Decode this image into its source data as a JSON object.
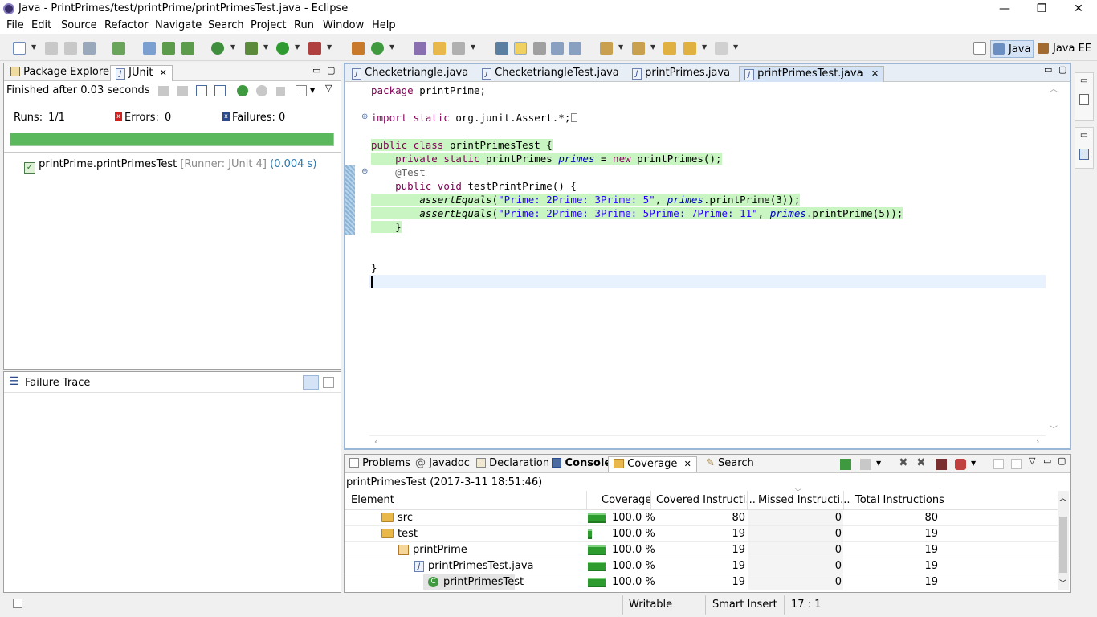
{
  "window": {
    "title": "Java - PrintPrimes/test/printPrime/printPrimesTest.java - Eclipse",
    "minimize": "—",
    "restore": "❐",
    "close": "✕"
  },
  "menu": [
    "File",
    "Edit",
    "Source",
    "Refactor",
    "Navigate",
    "Search",
    "Project",
    "Run",
    "Window",
    "Help"
  ],
  "perspectives": {
    "java": "Java",
    "javaee": "Java EE"
  },
  "left_panel": {
    "tabs": {
      "package_explorer": "Package Explorer",
      "junit": "JUnit"
    },
    "finished": "Finished after 0.03 seconds",
    "runs_label": "Runs:",
    "runs_value": "1/1",
    "errors_label": "Errors:",
    "errors_value": "0",
    "failures_label": "Failures:",
    "failures_value": "0",
    "progress": 1.0,
    "test_name": "printPrime.printPrimesTest",
    "test_runner": "[Runner: JUnit 4]",
    "test_time": "(0.004 s)",
    "failure_trace": "Failure Trace"
  },
  "editor": {
    "tabs": [
      "Checketriangle.java",
      "ChecketriangleTest.java",
      "printPrimes.java",
      "printPrimesTest.java"
    ],
    "active_tab": "printPrimesTest.java",
    "lines": {
      "l1_kw": "package",
      "l1_rest": " printPrime;",
      "l3_kw": "import static",
      "l3_rest": " org.junit.Assert.*;",
      "l5_kw": "public class",
      "l5_rest": " printPrimesTest {",
      "l6_kw": "private static",
      "l6_type": " printPrimes ",
      "l6_field": "primes",
      "l6_eq": " = ",
      "l6_new": "new",
      "l6_rest": " printPrimes();",
      "l7_ann": "@Test",
      "l8_kw": "public void",
      "l8_rest": " testPrintPrime() {",
      "l9_method": "assertEquals",
      "l9_open": "(",
      "l9_str": "\"Prime: 2Prime: 3Prime: 5\"",
      "l9_comma": ", ",
      "l9_field": "primes",
      "l9_rest": ".printPrime(3));",
      "l10_method": "assertEquals",
      "l10_open": "(",
      "l10_str": "\"Prime: 2Prime: 3Prime: 5Prime: 7Prime: 11\"",
      "l10_comma": ", ",
      "l10_field": "primes",
      "l10_rest": ".printPrime(5));",
      "l11": "}",
      "l14": "}"
    }
  },
  "bottom_panel": {
    "tabs": {
      "problems": "Problems",
      "javadoc": "Javadoc",
      "declaration": "Declaration",
      "console": "Console",
      "coverage": "Coverage",
      "search": "Search"
    },
    "session": "printPrimesTest (2017-3-11 18:51:46)",
    "columns": [
      "Element",
      "Coverage",
      "Covered Instructi...",
      "Missed Instructi...",
      "Total Instructions"
    ],
    "rows": [
      {
        "name": "src",
        "coverage": "100.0 %",
        "covered": "80",
        "missed": "0",
        "total": "80"
      },
      {
        "name": "test",
        "coverage": "100.0 %",
        "covered": "19",
        "missed": "0",
        "total": "19"
      },
      {
        "name": "printPrime",
        "coverage": "100.0 %",
        "covered": "19",
        "missed": "0",
        "total": "19"
      },
      {
        "name": "printPrimesTest.java",
        "coverage": "100.0 %",
        "covered": "19",
        "missed": "0",
        "total": "19"
      },
      {
        "name": "printPrimesTest",
        "coverage": "100.0 %",
        "covered": "19",
        "missed": "0",
        "total": "19"
      }
    ]
  },
  "status": {
    "writable": "Writable",
    "insert": "Smart Insert",
    "position": "17 : 1"
  }
}
